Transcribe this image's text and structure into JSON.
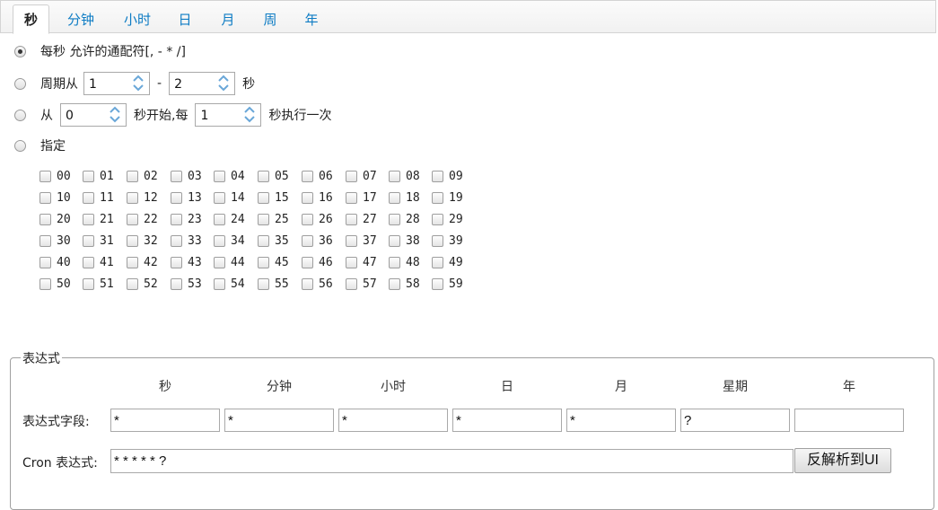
{
  "tabs": [
    {
      "label": "秒",
      "active": true
    },
    {
      "label": "分钟",
      "active": false
    },
    {
      "label": "小时",
      "active": false
    },
    {
      "label": "日",
      "active": false
    },
    {
      "label": "月",
      "active": false
    },
    {
      "label": "周",
      "active": false
    },
    {
      "label": "年",
      "active": false
    }
  ],
  "options": {
    "every": {
      "label": "每秒 允许的通配符[, - * /]",
      "checked": true
    },
    "cycle": {
      "label_prefix": "周期从",
      "from": "1",
      "separator": "-",
      "to": "2",
      "unit": "秒",
      "checked": false
    },
    "start": {
      "label_prefix": "从",
      "start": "0",
      "middle": "秒开始,每",
      "interval": "1",
      "suffix": "秒执行一次",
      "checked": false
    },
    "specify": {
      "label": "指定",
      "checked": false
    }
  },
  "checkbox_values": [
    [
      "00",
      "01",
      "02",
      "03",
      "04",
      "05",
      "06",
      "07",
      "08",
      "09"
    ],
    [
      "10",
      "11",
      "12",
      "13",
      "14",
      "15",
      "16",
      "17",
      "18",
      "19"
    ],
    [
      "20",
      "21",
      "22",
      "23",
      "24",
      "25",
      "26",
      "27",
      "28",
      "29"
    ],
    [
      "30",
      "31",
      "32",
      "33",
      "34",
      "35",
      "36",
      "37",
      "38",
      "39"
    ],
    [
      "40",
      "41",
      "42",
      "43",
      "44",
      "45",
      "46",
      "47",
      "48",
      "49"
    ],
    [
      "50",
      "51",
      "52",
      "53",
      "54",
      "55",
      "56",
      "57",
      "58",
      "59"
    ]
  ],
  "expression": {
    "legend": "表达式",
    "columns": [
      "秒",
      "分钟",
      "小时",
      "日",
      "月",
      "星期",
      "年"
    ],
    "field_label": "表达式字段:",
    "field_values": [
      "*",
      "*",
      "*",
      "*",
      "*",
      "?",
      ""
    ],
    "cron_label": "Cron 表达式:",
    "cron_value": "* * * * * ?",
    "parse_button": "反解析到UI"
  }
}
